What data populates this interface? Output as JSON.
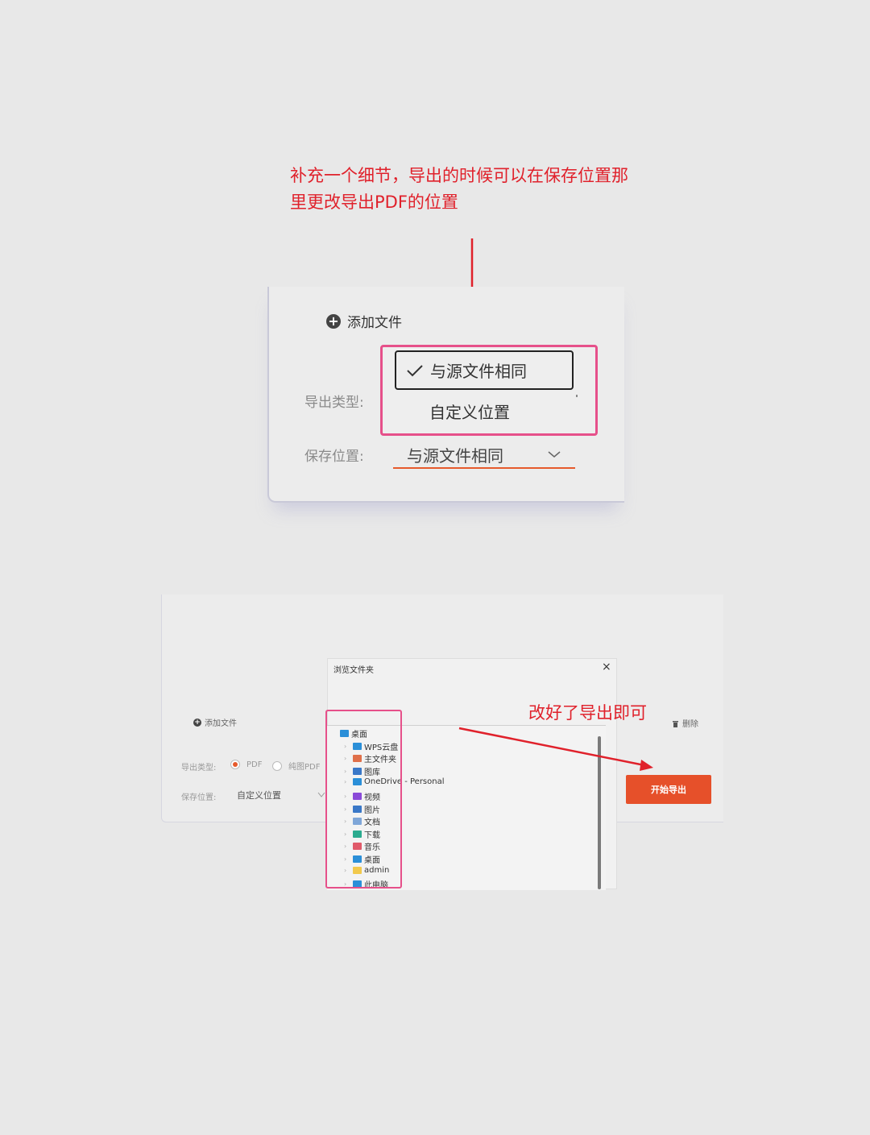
{
  "annotations": {
    "top_note_line1": "补充一个细节，导出的时候可以在保存位置那",
    "top_note_line2": "里更改导出PDF的位置",
    "bottom_note": "改好了导出即可"
  },
  "top_panel": {
    "add_file": "添加文件",
    "export_type_label": "导出类型:",
    "save_location_label": "保存位置:",
    "save_location_value": "与源文件相同",
    "dropdown_options": [
      "与源文件相同",
      "自定义位置"
    ],
    "selected_option": "与源文件相同"
  },
  "bottom_panel": {
    "add_file": "添加文件",
    "delete": "删除",
    "export_type_label": "导出类型:",
    "radio_pdf": "PDF",
    "radio_image_pdf": "纯图PDF",
    "save_location_label": "保存位置:",
    "save_location_value": "自定义位置",
    "start_export": "开始导出"
  },
  "browse_dialog": {
    "title": "浏览文件夹",
    "close": "×",
    "tree": [
      {
        "label": "桌面",
        "icon": "desktop-icon",
        "color": "#2b8fd8"
      },
      {
        "label": "WPS云盘",
        "icon": "cloud-icon",
        "color": "#2b8fd8"
      },
      {
        "label": "主文件夹",
        "icon": "home-icon",
        "color": "#e0704a"
      },
      {
        "label": "图库",
        "icon": "gallery-icon",
        "color": "#3a78c8"
      },
      {
        "label": "OneDrive - Personal",
        "icon": "onedrive-icon",
        "color": "#2b8fd8"
      },
      {
        "label": "视频",
        "icon": "video-icon",
        "color": "#8a4ad8"
      },
      {
        "label": "图片",
        "icon": "pictures-icon",
        "color": "#3a78c8"
      },
      {
        "label": "文档",
        "icon": "documents-icon",
        "color": "#7fa6d8"
      },
      {
        "label": "下载",
        "icon": "download-icon",
        "color": "#2bab8f"
      },
      {
        "label": "音乐",
        "icon": "music-icon",
        "color": "#e05a6a"
      },
      {
        "label": "桌面",
        "icon": "desktop-icon",
        "color": "#2b8fd8"
      },
      {
        "label": "admin",
        "icon": "folder-icon",
        "color": "#f2c94c"
      },
      {
        "label": "此电脑",
        "icon": "computer-icon",
        "color": "#2b8fd8"
      }
    ]
  },
  "colors": {
    "accent": "#e6502a",
    "annotation_red": "#e0212b",
    "highlight_pink": "#e6508a"
  }
}
